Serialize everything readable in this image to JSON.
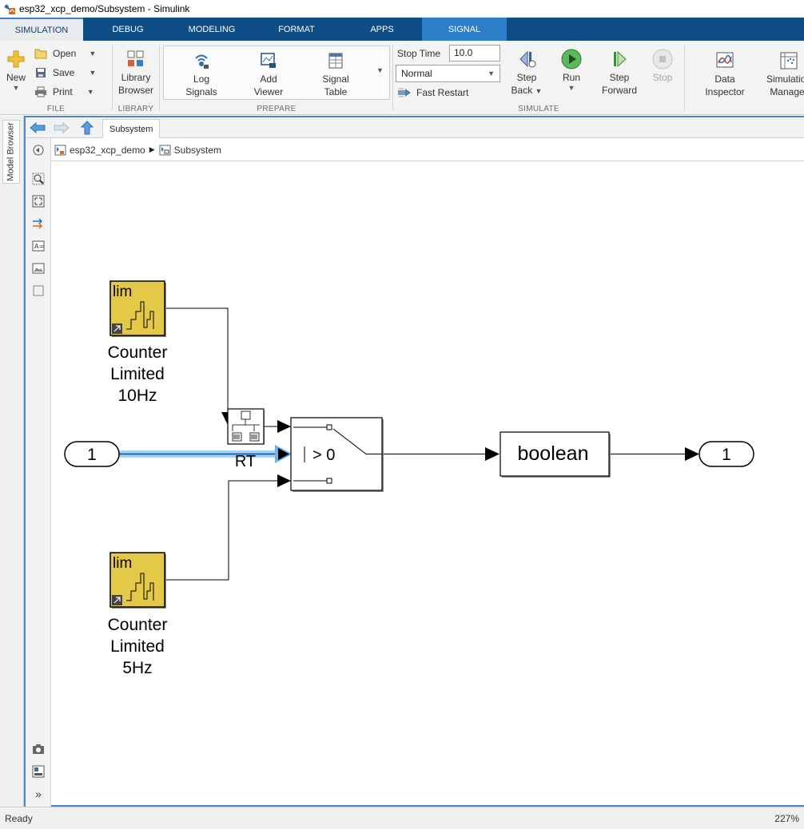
{
  "window": {
    "title": "esp32_xcp_demo/Subsystem - Simulink"
  },
  "tabs": [
    {
      "label": "SIMULATION"
    },
    {
      "label": "DEBUG"
    },
    {
      "label": "MODELING"
    },
    {
      "label": "FORMAT"
    },
    {
      "label": "APPS"
    },
    {
      "label": "SIGNAL"
    }
  ],
  "ribbon": {
    "file": {
      "new": "New",
      "open": "Open",
      "save": "Save",
      "print": "Print",
      "group": "FILE"
    },
    "library": {
      "browser_line1": "Library",
      "browser_line2": "Browser",
      "group": "LIBRARY"
    },
    "prepare": {
      "log_line1": "Log",
      "log_line2": "Signals",
      "viewer_line1": "Add",
      "viewer_line2": "Viewer",
      "table_line1": "Signal",
      "table_line2": "Table",
      "group": "PREPARE"
    },
    "simulate": {
      "stop_time_label": "Stop Time",
      "stop_time_value": "10.0",
      "mode": "Normal",
      "fast_restart": "Fast Restart",
      "step_back_line1": "Step",
      "step_back_line2": "Back",
      "run": "Run",
      "step_forward_line1": "Step",
      "step_forward_line2": "Forward",
      "stop": "Stop",
      "group": "SIMULATE"
    },
    "review": {
      "data_inspector_line1": "Data",
      "data_inspector_line2": "Inspector",
      "sim_manager_line1": "Simulation",
      "sim_manager_line2": "Manager"
    }
  },
  "sidebar": {
    "model_browser": "Model Browser"
  },
  "editor": {
    "tab": "Subsystem",
    "breadcrumb": [
      "esp32_xcp_demo",
      "Subsystem"
    ]
  },
  "diagram": {
    "inport": "1",
    "outport": "1",
    "counter_top": {
      "icon_text": "lim",
      "name_line1": "Counter",
      "name_line2": "Limited",
      "name_line3": "10Hz"
    },
    "counter_bottom": {
      "icon_text": "lim",
      "name_line1": "Counter",
      "name_line2": "Limited",
      "name_line3": "5Hz"
    },
    "rate_transition": "RT",
    "switch_criterion": "> 0",
    "convert": "boolean"
  },
  "status": {
    "left": "Ready",
    "zoom": "227%"
  },
  "colors": {
    "tabstrip": "#0f4d86",
    "signal_tab": "#2d7fca",
    "block_yellow": "#e4c948",
    "signal_highlight": "#6ab4ec"
  }
}
